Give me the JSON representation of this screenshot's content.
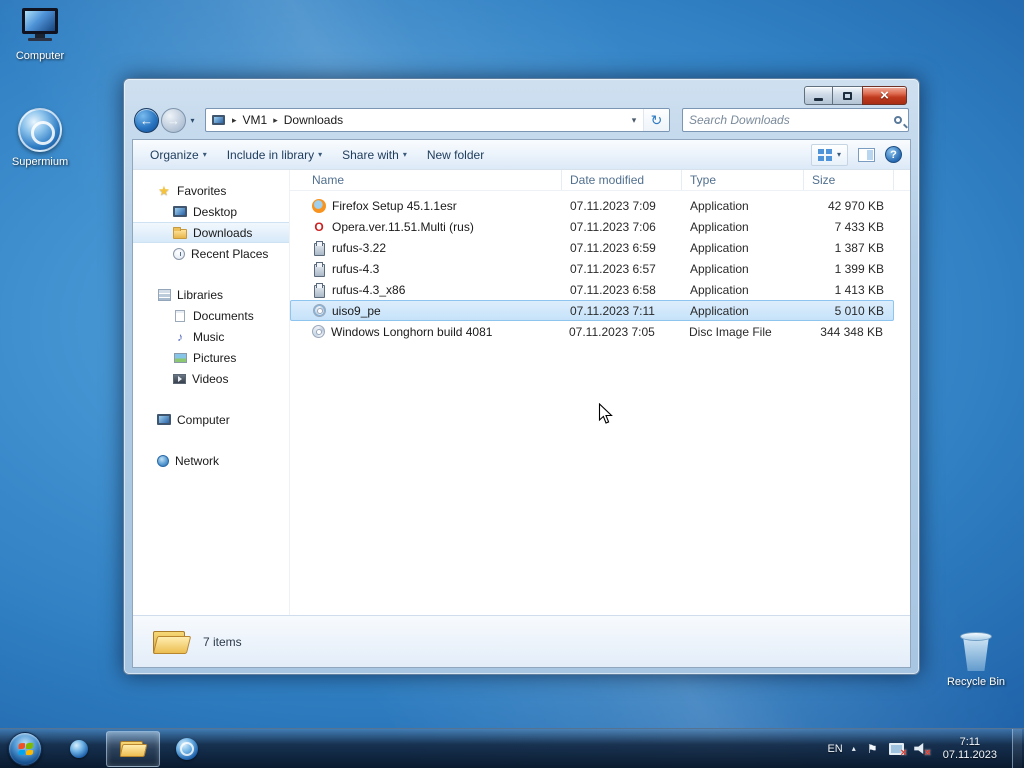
{
  "desktop": {
    "icons": {
      "computer": "Computer",
      "supermium": "Supermium",
      "recycle_bin": "Recycle Bin"
    }
  },
  "explorer": {
    "nav": {
      "breadcrumb_root": "VM1",
      "breadcrumb_folder": "Downloads",
      "search_placeholder": "Search Downloads"
    },
    "toolbar": {
      "organize": "Organize",
      "include_in_library": "Include in library",
      "share_with": "Share with",
      "new_folder": "New folder"
    },
    "sidebar": {
      "favorites": "Favorites",
      "favorites_items": [
        "Desktop",
        "Downloads",
        "Recent Places"
      ],
      "libraries": "Libraries",
      "libraries_items": [
        "Documents",
        "Music",
        "Pictures",
        "Videos"
      ],
      "computer": "Computer",
      "network": "Network"
    },
    "columns": [
      "Name",
      "Date modified",
      "Type",
      "Size"
    ],
    "files": [
      {
        "name": "Firefox Setup 45.1.1esr",
        "date_modified": "07.11.2023 7:09",
        "type": "Application",
        "size": "42 970 KB",
        "icon": "firefox-icon",
        "selected": false
      },
      {
        "name": "Opera.ver.11.51.Multi (rus)",
        "date_modified": "07.11.2023 7:06",
        "type": "Application",
        "size": "7 433 KB",
        "icon": "opera-icon",
        "selected": false
      },
      {
        "name": "rufus-3.22",
        "date_modified": "07.11.2023 6:59",
        "type": "Application",
        "size": "1 387 KB",
        "icon": "rufus-icon",
        "selected": false
      },
      {
        "name": "rufus-4.3",
        "date_modified": "07.11.2023 6:57",
        "type": "Application",
        "size": "1 399 KB",
        "icon": "rufus-icon",
        "selected": false
      },
      {
        "name": "rufus-4.3_x86",
        "date_modified": "07.11.2023 6:58",
        "type": "Application",
        "size": "1 413 KB",
        "icon": "rufus-icon",
        "selected": false
      },
      {
        "name": "uiso9_pe",
        "date_modified": "07.11.2023 7:11",
        "type": "Application",
        "size": "5 010 KB",
        "icon": "uiso-icon",
        "selected": true
      },
      {
        "name": "Windows Longhorn build 4081",
        "date_modified": "07.11.2023 7:05",
        "type": "Disc Image File",
        "size": "344 348 KB",
        "icon": "disc-icon",
        "selected": false
      }
    ],
    "status_bar": {
      "items_count": "7 items"
    }
  },
  "taskbar": {
    "tray": {
      "language": "EN",
      "time": "7:11",
      "date": "07.11.2023"
    }
  },
  "colors": {
    "selection_fill": "#c6e2f9",
    "selection_border": "#8ec5ef",
    "close_button_red": "#c03a1e",
    "desktop_blue": "#3181c4",
    "taskbar_dark": "#0a1e33"
  }
}
